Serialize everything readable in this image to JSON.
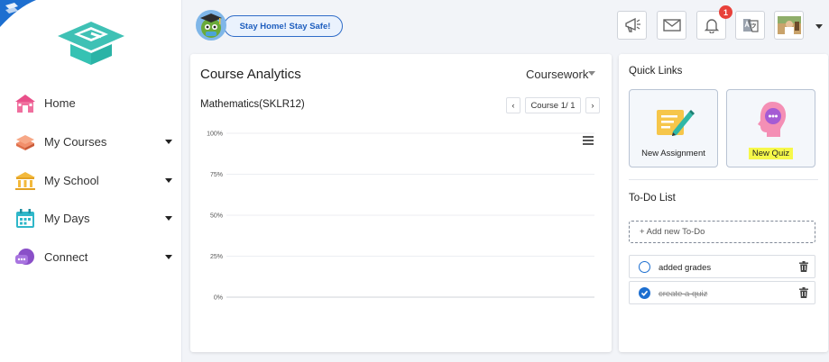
{
  "sidebar": {
    "items": [
      {
        "label": "Home",
        "icon": "home-icon",
        "has_caret": false
      },
      {
        "label": "My Courses",
        "icon": "courses-icon",
        "has_caret": true
      },
      {
        "label": "My School",
        "icon": "school-icon",
        "has_caret": true
      },
      {
        "label": "My Days",
        "icon": "calendar-icon",
        "has_caret": true
      },
      {
        "label": "Connect",
        "icon": "connect-icon",
        "has_caret": true
      }
    ]
  },
  "header": {
    "banner_text": "Stay Home! Stay Safe!",
    "notification_count": "1",
    "buttons": [
      "announcement-icon",
      "mail-icon",
      "bell-icon",
      "translate-icon",
      "profile-avatar"
    ]
  },
  "analytics": {
    "title": "Course Analytics",
    "filter": "Coursework",
    "subject": "Mathematics(SKLR12)",
    "pager_label": "Course 1/ 1",
    "prev": "‹",
    "next": "›"
  },
  "chart_data": {
    "type": "bar",
    "categories": [],
    "series": [],
    "y_ticks": [
      "100%",
      "75%",
      "50%",
      "25%",
      "0%"
    ],
    "ylim": [
      0,
      100
    ],
    "grid": true
  },
  "quick_links": {
    "title": "Quick Links",
    "items": [
      {
        "label": "New Assignment",
        "icon": "assignment-icon"
      },
      {
        "label": "New Quiz",
        "icon": "quiz-icon"
      }
    ]
  },
  "todo": {
    "title": "To-Do List",
    "add_placeholder": "+ Add new To-Do",
    "items": [
      {
        "text": "added grades",
        "done": false
      },
      {
        "text": "create a quiz",
        "done": true
      }
    ]
  },
  "colors": {
    "accent": "#1d6fd0",
    "logo_teal": "#3fc1b5",
    "badge_red": "#e8413a",
    "highlight": "#f6f84a"
  }
}
